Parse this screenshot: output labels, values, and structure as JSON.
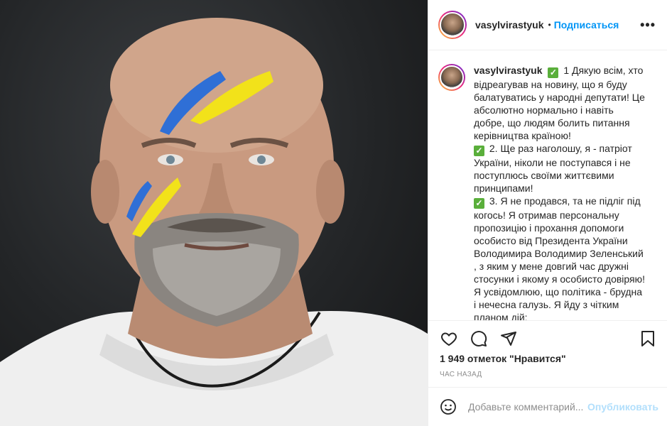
{
  "post": {
    "username": "vasylvirastyuk",
    "separator": "•",
    "follow_label": "Подписаться",
    "more_label": "•••"
  },
  "caption": {
    "username": "vasylvirastyuk",
    "lines": [
      "1 Дякую всім, хто",
      "відреагував на новину, що я буду",
      "балатуватись у народні депутати! Це",
      "абсолютно нормально і навіть",
      "добре, що людям болить питання",
      "керівництва країною!",
      "2. Ще раз наголошу, я - патріот",
      "України, ніколи не поступався і не",
      "поступлюсь своїми життєвими",
      "принципами!",
      "3. Я не продався, та не підліг під",
      "когось! Я отримав персональну",
      "пропозицію і прохання допомоги",
      "особисто від Президента України",
      "Володимира Володимир Зеленський",
      ", з яким у мене довгий час дружні",
      "стосунки і якому я особисто довіряю!",
      "Я усвідомлюю, що політика - брудна",
      "і нечесна галузь. Я йду з чітким",
      "планом дій:"
    ],
    "check_symbol": "✓"
  },
  "stats": {
    "likes": "1 949 отметок \"Нравится\"",
    "time": "час назад"
  },
  "comment": {
    "placeholder": "Добавьте комментарий...",
    "publish_label": "Опубликовать"
  },
  "icons": {
    "like": "heart-icon",
    "comment": "comment-icon",
    "share": "paper-plane-icon",
    "save": "bookmark-icon",
    "emoji": "smiley-icon"
  },
  "colors": {
    "accent": "#0095f6",
    "publish_disabled": "#b2dffc",
    "check_green": "#5aaf3b",
    "flag_blue": "#2f6fd6",
    "flag_yellow": "#f2e21a"
  }
}
